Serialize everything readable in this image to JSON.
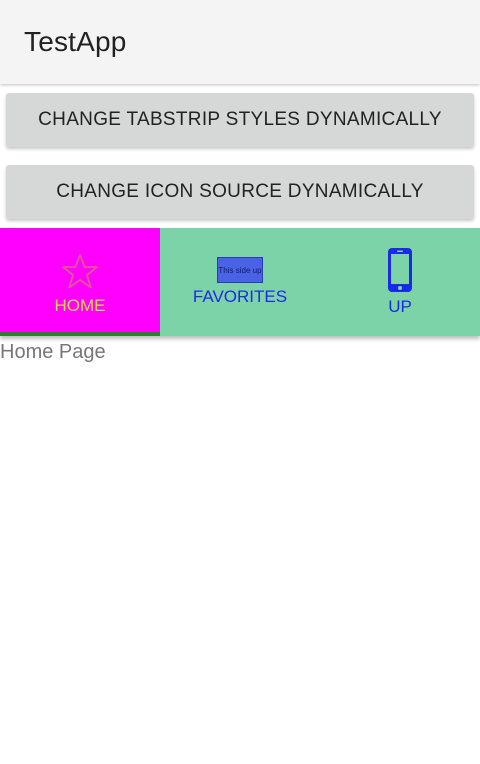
{
  "app": {
    "title": "TestApp"
  },
  "buttons": {
    "tabstrip_styles": "CHANGE TABSTRIP STYLES DYNAMICALLY",
    "icon_source": "CHANGE ICON SOURCE DYNAMICALLY"
  },
  "tabs": [
    {
      "label": "HOME",
      "icon": "star-icon",
      "selected": true
    },
    {
      "label": "FAVORITES",
      "icon": "this-side-up-icon",
      "icon_text": "This side up",
      "selected": false
    },
    {
      "label": "UP",
      "icon": "phone-icon",
      "selected": false
    }
  ],
  "content": {
    "text": "Home Page"
  },
  "colors": {
    "app_bar": "#f4f4f4",
    "button_bg": "#d6d7d7",
    "tabstrip_bg": "#7dd3a8",
    "selected_tab_bg": "#ff00ff",
    "selected_label": "#f2d64a",
    "label": "#1a2be8",
    "indicator": "#2d7f2d"
  }
}
